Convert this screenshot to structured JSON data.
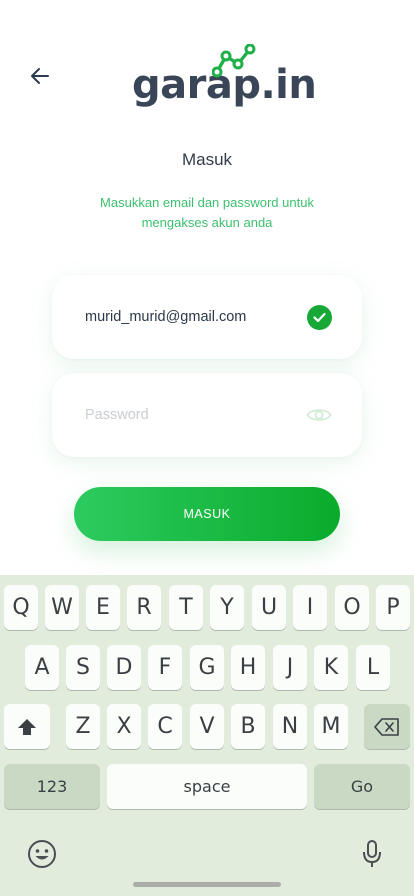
{
  "logo": {
    "text": "garap.in"
  },
  "header": {
    "title": "Masuk",
    "subtitle": "Masukkan email dan password untuk mengakses akun anda"
  },
  "form": {
    "email_value": "murid_murid@gmail.com",
    "password_placeholder": "Password",
    "submit_label": "MASUK"
  },
  "keyboard": {
    "row1": [
      "Q",
      "W",
      "E",
      "R",
      "T",
      "Y",
      "U",
      "I",
      "O",
      "P"
    ],
    "row2": [
      "A",
      "S",
      "D",
      "F",
      "G",
      "H",
      "J",
      "K",
      "L"
    ],
    "row3": [
      "Z",
      "X",
      "C",
      "V",
      "B",
      "N",
      "M"
    ],
    "numbers_label": "123",
    "space_label": "space",
    "go_label": "Go"
  },
  "colors": {
    "accent": "#17a838",
    "brand_text": "#3a4658",
    "subtitle": "#3cbf6f",
    "keyboard_bg": "#e1ecdd"
  },
  "icons": [
    "back-arrow-icon",
    "check-icon",
    "eye-icon",
    "shift-icon",
    "backspace-icon",
    "emoji-icon",
    "microphone-icon"
  ]
}
